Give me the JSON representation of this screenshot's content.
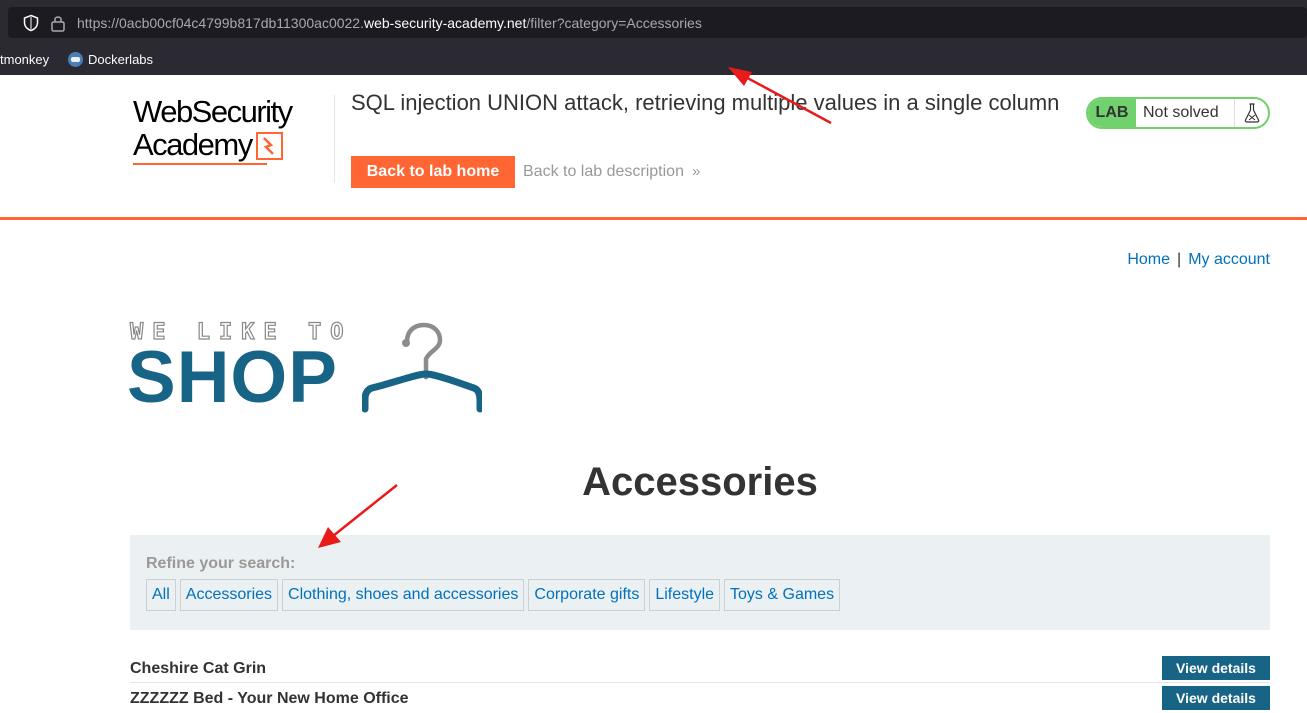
{
  "browser": {
    "url_prefix": "https://0acb00cf04c4799b817db11300ac0022.",
    "url_host": "web-security-academy.net",
    "url_path": "/filter?category=Accessories",
    "bookmarks": [
      {
        "label": "tmonkey"
      },
      {
        "label": "Dockerlabs"
      }
    ]
  },
  "lab_header": {
    "logo_line1": "WebSecurity",
    "logo_line2": "Academy",
    "title": "SQL injection UNION attack, retrieving multiple values in a single column",
    "back_home_label": "Back to lab home",
    "back_desc_label": "Back to lab description",
    "badge": "LAB",
    "status": "Not solved"
  },
  "nav": {
    "home": "Home",
    "separator": "|",
    "account": "My account"
  },
  "shop_logo": {
    "tagline": "WE LIKE TO",
    "word": "SHOP"
  },
  "page": {
    "heading": "Accessories"
  },
  "filter": {
    "label": "Refine your search:",
    "categories": [
      "All",
      "Accessories",
      "Clothing, shoes and accessories",
      "Corporate gifts",
      "Lifestyle",
      "Toys & Games"
    ]
  },
  "products": [
    {
      "name": "Cheshire Cat Grin",
      "button": "View details"
    },
    {
      "name": "ZZZZZZ Bed - Your New Home Office",
      "button": "View details"
    }
  ],
  "colors": {
    "accent_orange": "#ff6633",
    "shop_blue": "#186486",
    "link_blue": "#0071bc",
    "lab_green": "#70d16d",
    "annotation_red": "#e81a1a"
  },
  "icons": [
    "shield-icon",
    "lock-icon",
    "chevron-right-icon",
    "flask-icon",
    "hanger-icon",
    "arrow-annotation"
  ]
}
